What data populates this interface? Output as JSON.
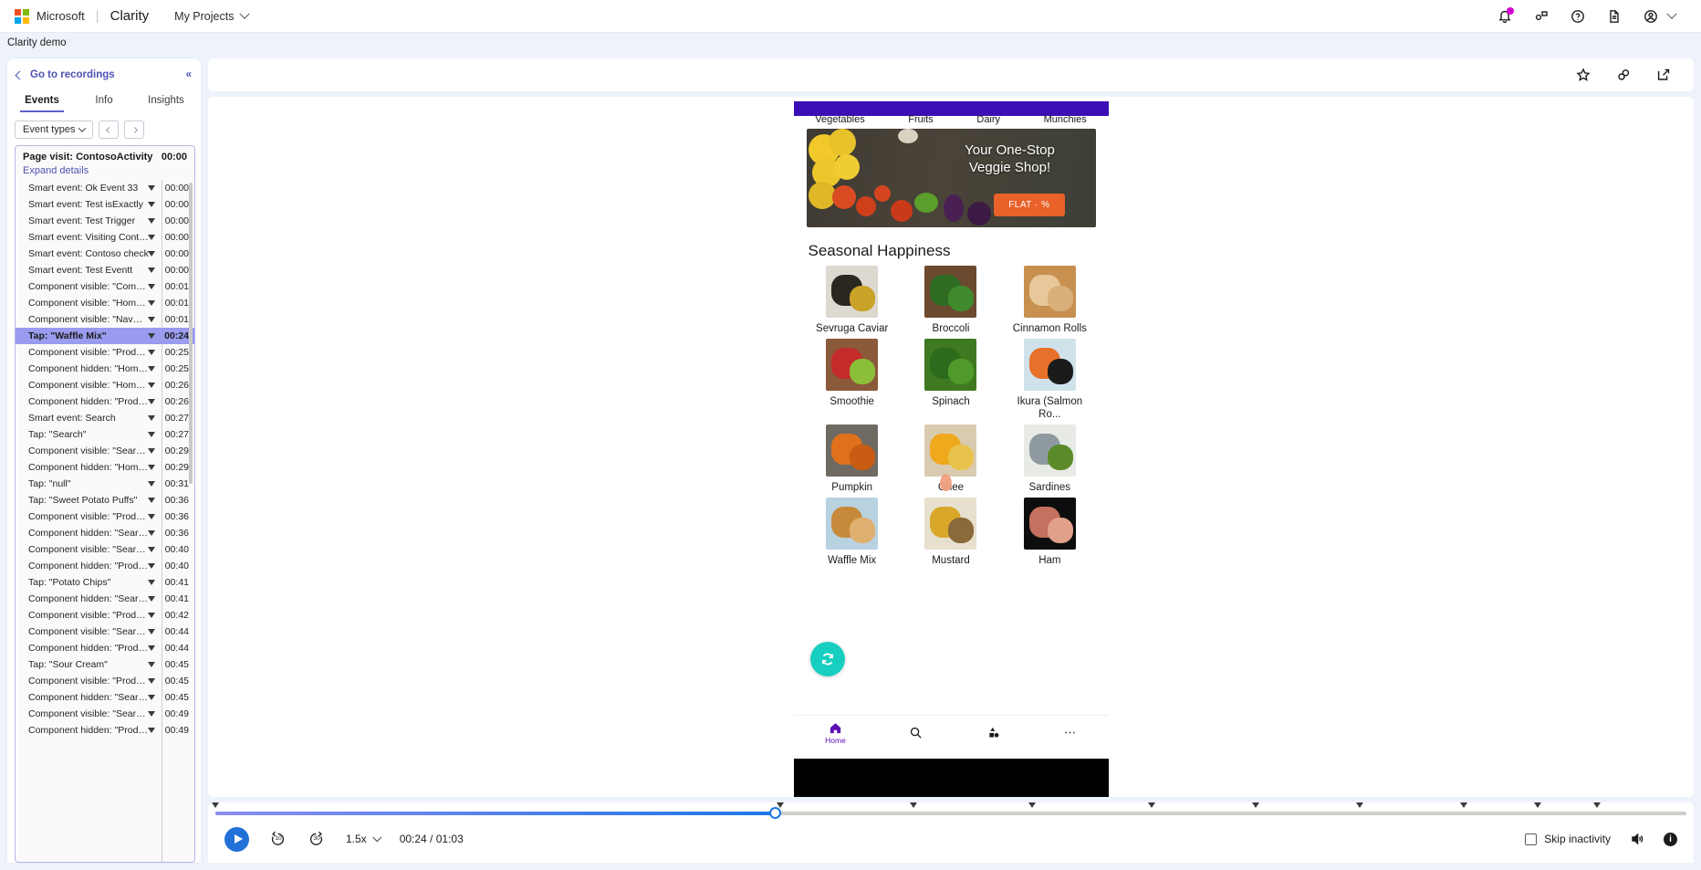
{
  "topbar": {
    "brand": "Microsoft",
    "product": "Clarity",
    "projects_label": "My Projects",
    "icons": [
      "notification-bell-icon",
      "feedback-icon",
      "help-icon",
      "docs-icon",
      "account-icon"
    ]
  },
  "breadcrumb": "Clarity demo",
  "sidebar": {
    "back_label": "Go to recordings",
    "collapse_label": "«",
    "tabs": [
      {
        "label": "Events",
        "active": true
      },
      {
        "label": "Info",
        "active": false
      },
      {
        "label": "Insights",
        "active": false
      }
    ],
    "filter_label": "Event types",
    "page_visit": {
      "label": "Page visit: ContosoActivity",
      "time": "00:00"
    },
    "expand_label": "Expand details",
    "events": [
      {
        "label": "Smart event: Ok Event 33",
        "time": "00:00",
        "selected": false
      },
      {
        "label": "Smart event: Test isExactly",
        "time": "00:00",
        "selected": false
      },
      {
        "label": "Smart event: Test Trigger",
        "time": "00:00",
        "selected": false
      },
      {
        "label": "Smart event: Visiting ContosoAct...",
        "time": "00:00",
        "selected": false
      },
      {
        "label": "Smart event: Contoso check",
        "time": "00:00",
        "selected": false
      },
      {
        "label": "Smart event: Test Eventt",
        "time": "00:00",
        "selected": false
      },
      {
        "label": "Component visible: \"CommonFr...",
        "time": "00:01",
        "selected": false
      },
      {
        "label": "Component visible: \"HomeFrag...",
        "time": "00:01",
        "selected": false
      },
      {
        "label": "Component visible: \"NavHostFra...",
        "time": "00:01",
        "selected": false
      },
      {
        "label": "Tap: \"Waffle Mix\"",
        "time": "00:24",
        "selected": true
      },
      {
        "label": "Component visible: \"ProductFrag...",
        "time": "00:25",
        "selected": false
      },
      {
        "label": "Component hidden: \"HomeFrag...",
        "time": "00:25",
        "selected": false
      },
      {
        "label": "Component visible: \"HomeFrag...",
        "time": "00:26",
        "selected": false
      },
      {
        "label": "Component hidden: \"ProductFra...",
        "time": "00:26",
        "selected": false
      },
      {
        "label": "Smart event: Search",
        "time": "00:27",
        "selected": false
      },
      {
        "label": "Tap: \"Search\"",
        "time": "00:27",
        "selected": false
      },
      {
        "label": "Component visible: \"SearchFrag...",
        "time": "00:29",
        "selected": false
      },
      {
        "label": "Component hidden: \"HomeFrag...",
        "time": "00:29",
        "selected": false
      },
      {
        "label": "Tap: \"null\"",
        "time": "00:31",
        "selected": false
      },
      {
        "label": "Tap: \"Sweet Potato Puffs\"",
        "time": "00:36",
        "selected": false
      },
      {
        "label": "Component visible: \"ProductFrag...",
        "time": "00:36",
        "selected": false
      },
      {
        "label": "Component hidden: \"SearchFrag...",
        "time": "00:36",
        "selected": false
      },
      {
        "label": "Component visible: \"SearchFrag...",
        "time": "00:40",
        "selected": false
      },
      {
        "label": "Component hidden: \"ProductFra...",
        "time": "00:40",
        "selected": false
      },
      {
        "label": "Tap: \"Potato Chips\"",
        "time": "00:41",
        "selected": false
      },
      {
        "label": "Component hidden: \"SearchFrag...",
        "time": "00:41",
        "selected": false
      },
      {
        "label": "Component visible: \"ProductFrag...",
        "time": "00:42",
        "selected": false
      },
      {
        "label": "Component visible: \"SearchFrag...",
        "time": "00:44",
        "selected": false
      },
      {
        "label": "Component hidden: \"ProductFra...",
        "time": "00:44",
        "selected": false
      },
      {
        "label": "Tap: \"Sour Cream\"",
        "time": "00:45",
        "selected": false
      },
      {
        "label": "Component visible: \"ProductFrag...",
        "time": "00:45",
        "selected": false
      },
      {
        "label": "Component hidden: \"SearchFrag...",
        "time": "00:45",
        "selected": false
      },
      {
        "label": "Component visible: \"SearchFrag...",
        "time": "00:49",
        "selected": false
      },
      {
        "label": "Component hidden: \"ProductFra...",
        "time": "00:49",
        "selected": false
      }
    ]
  },
  "player_toolbar": {
    "icons": [
      "favorite-star-icon",
      "copy-link-icon",
      "share-icon"
    ]
  },
  "phone": {
    "nav_items": [
      "Vegetables",
      "Fruits",
      "Dairy",
      "Munchies"
    ],
    "hero_title_line1": "Your One-Stop",
    "hero_title_line2": "Veggie Shop!",
    "hero_cta": "FLAT · %",
    "section_title": "Seasonal Happiness",
    "products": [
      {
        "name": "Sevruga Caviar",
        "image": "caviar"
      },
      {
        "name": "Broccoli",
        "image": "broccoli"
      },
      {
        "name": "Cinnamon Rolls",
        "image": "cinnamon-rolls"
      },
      {
        "name": "Smoothie",
        "image": "smoothie"
      },
      {
        "name": "Spinach",
        "image": "spinach"
      },
      {
        "name": "Ikura (Salmon Ro...",
        "image": "ikura"
      },
      {
        "name": "Pumpkin",
        "image": "pumpkin"
      },
      {
        "name": "Ghee",
        "image": "ghee"
      },
      {
        "name": "Sardines",
        "image": "sardines"
      },
      {
        "name": "Waffle Mix",
        "image": "waffle"
      },
      {
        "name": "Mustard",
        "image": "mustard"
      },
      {
        "name": "Ham",
        "image": "ham"
      }
    ],
    "bottom_nav": [
      {
        "label": "Home",
        "icon": "home-icon",
        "active": true
      },
      {
        "label": "",
        "icon": "search-icon",
        "active": false
      },
      {
        "label": "",
        "icon": "categories-icon",
        "active": false
      },
      {
        "label": "",
        "icon": "more-icon",
        "active": false
      }
    ],
    "fab_icon": "refresh-icon",
    "accent_color": "#3b0fb5",
    "fab_color": "#17cfc0",
    "cta_color": "#e8622a"
  },
  "controls": {
    "play_label": "Play",
    "rewind_label": "10",
    "forward_label": "30",
    "speed": "1.5x",
    "time_current": "00:24",
    "time_total": "01:03",
    "time_display": "00:24 / 01:03",
    "skip_inactivity_label": "Skip inactivity",
    "skip_inactivity_checked": false,
    "volume_icon": "volume-icon",
    "info_icon": "info-icon",
    "progress_percent": 38,
    "marker_positions": [
      0,
      38,
      47,
      55,
      63,
      70,
      77,
      84,
      89,
      93
    ]
  }
}
